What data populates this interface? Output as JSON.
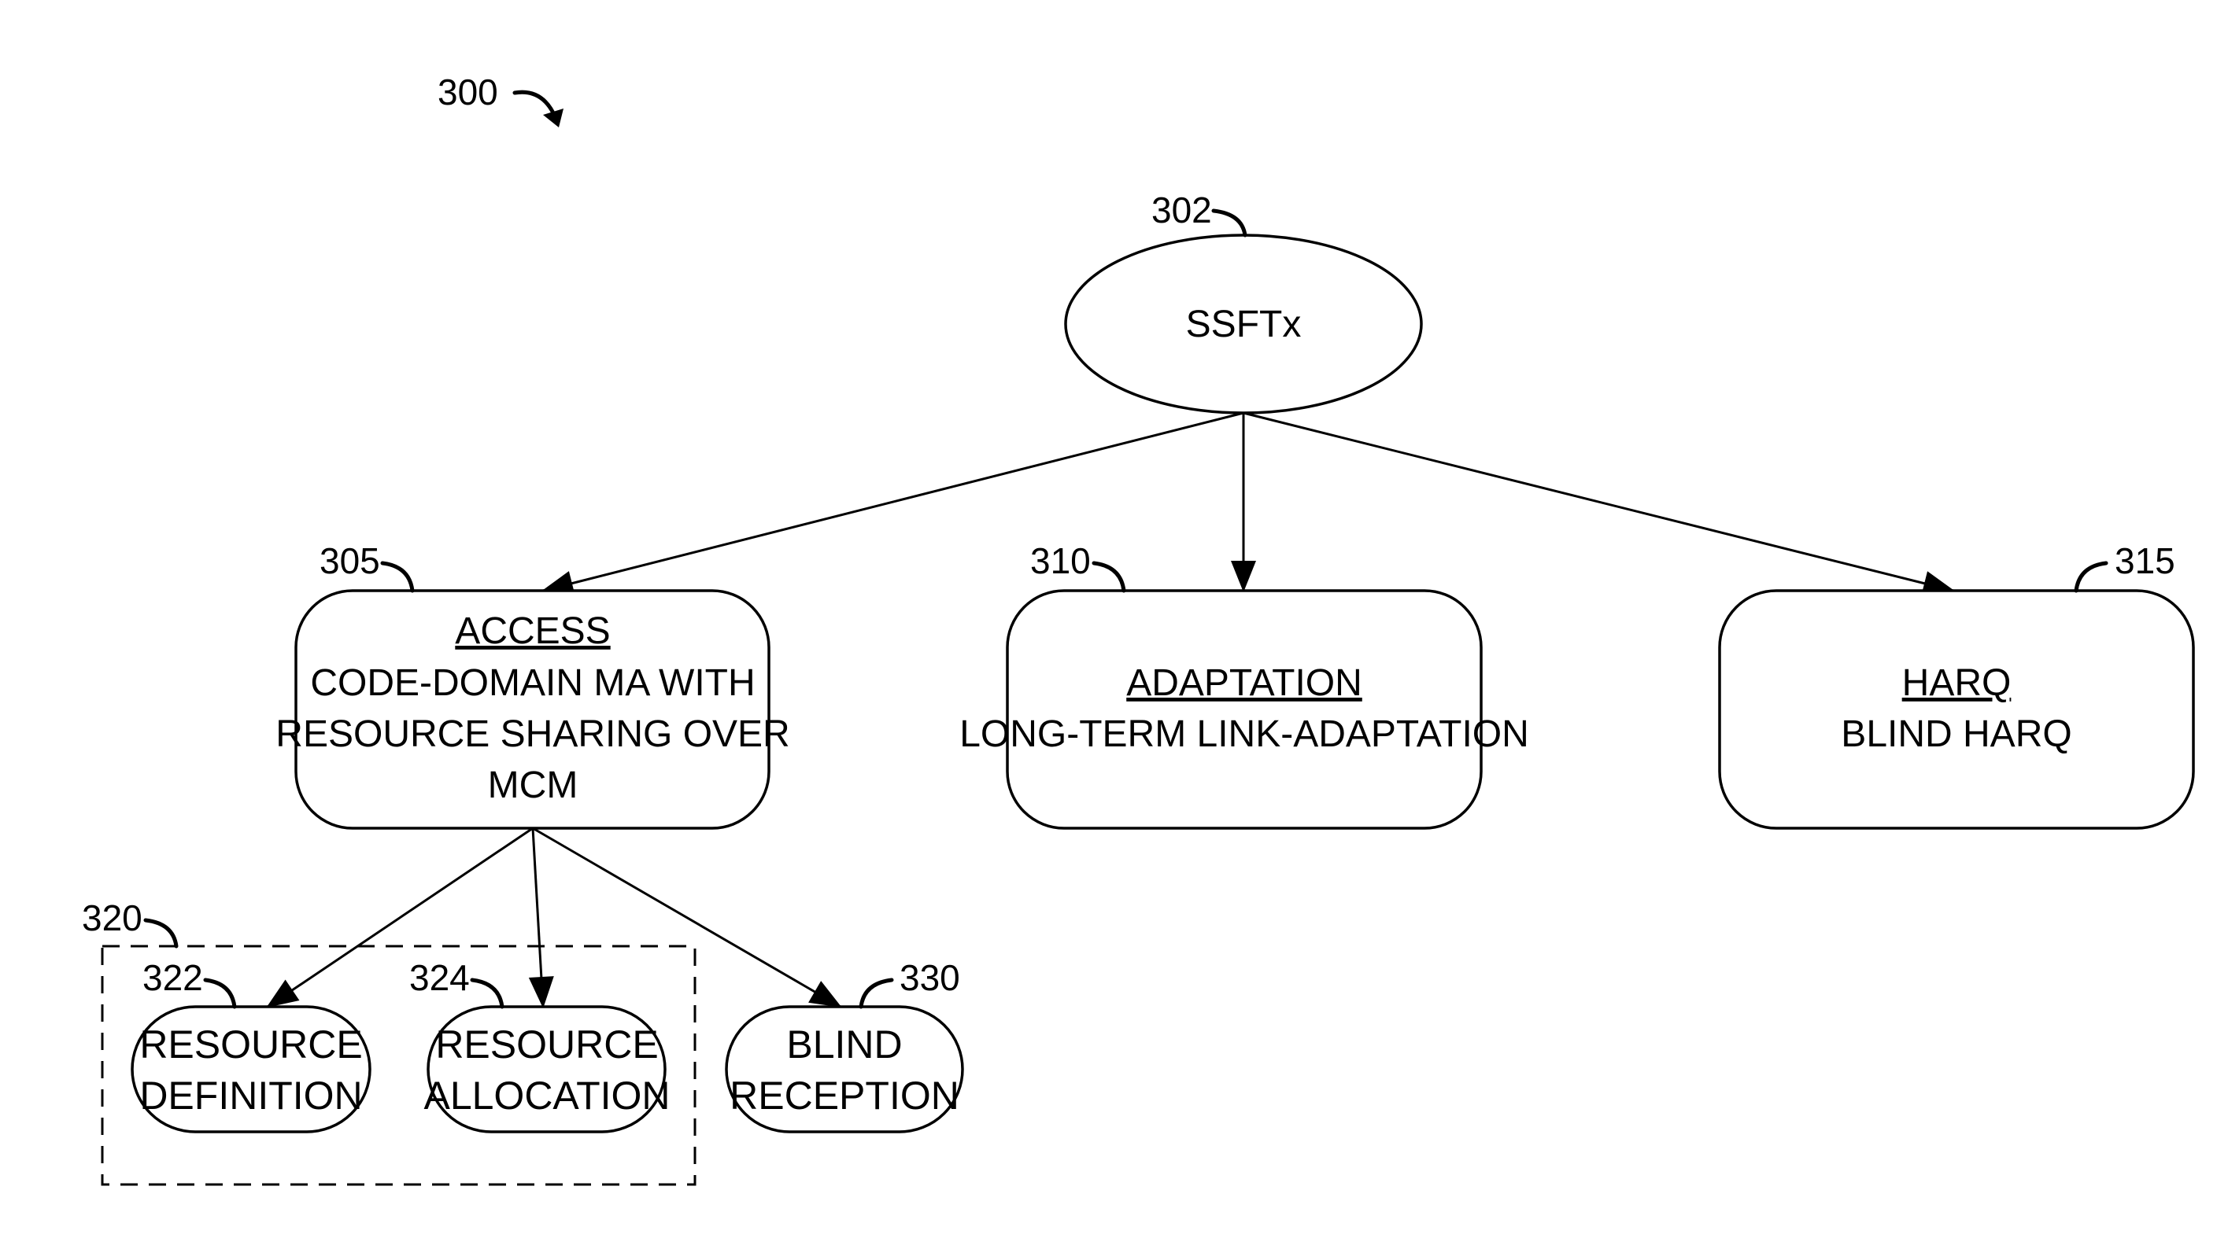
{
  "figure": {
    "ref": "300"
  },
  "root": {
    "ref": "302",
    "label": "SSFTx"
  },
  "nodes": [
    {
      "ref": "305",
      "title": "ACCESS",
      "lines": [
        "CODE-DOMAIN MA WITH",
        "RESOURCE SHARING OVER",
        "MCM"
      ]
    },
    {
      "ref": "310",
      "title": "ADAPTATION",
      "lines": [
        "LONG-TERM LINK-ADAPTATION"
      ]
    },
    {
      "ref": "315",
      "title": "HARQ",
      "lines": [
        "BLIND HARQ"
      ]
    }
  ],
  "group": {
    "ref": "320"
  },
  "subnodes": [
    {
      "ref": "322",
      "lines": [
        "RESOURCE",
        "DEFINITION"
      ]
    },
    {
      "ref": "324",
      "lines": [
        "RESOURCE",
        "ALLOCATION"
      ]
    },
    {
      "ref": "330",
      "lines": [
        "BLIND",
        "RECEPTION"
      ]
    }
  ],
  "edges": [
    {
      "from": "302",
      "to": "305"
    },
    {
      "from": "302",
      "to": "310"
    },
    {
      "from": "302",
      "to": "315"
    },
    {
      "from": "305",
      "to": "322"
    },
    {
      "from": "305",
      "to": "324"
    },
    {
      "from": "305",
      "to": "330"
    }
  ]
}
